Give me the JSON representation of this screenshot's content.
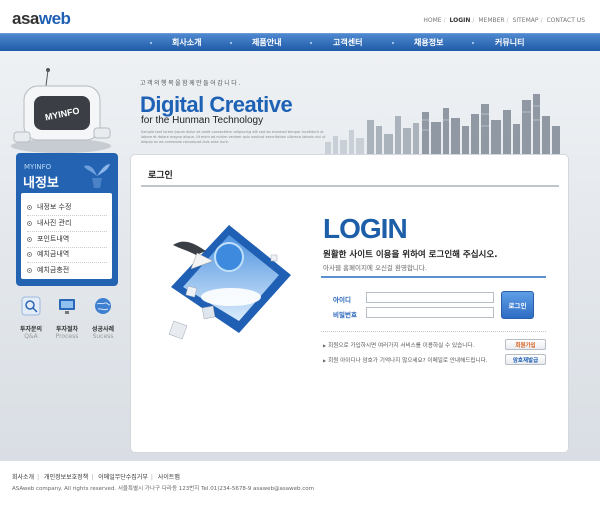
{
  "header": {
    "logo": {
      "part1": "asa",
      "part2": "web"
    },
    "top_links": [
      "HOME",
      "LOGIN",
      "MEMBER",
      "SITEMAP",
      "CONTACT US"
    ],
    "nav": [
      "회사소개",
      "제품안내",
      "고객센터",
      "채용정보",
      "커뮤니티"
    ]
  },
  "visual": {
    "tagline": "고객의행복을함께만들어갑니다.",
    "title_part1": "Digital ",
    "title_part2": "Creative",
    "subtitle": "for the Hunman Technology",
    "description": "Sample text lorem ipsum dolor sit amet consectetur adipiscing elit sed do eiusmod tempor incididunt ut labore et dolore magna aliqua. Ut enim ad minim veniam quis nostrud exercitation ullamco laboris nisi ut aliquip ex ea commodo consequat duis aute irure."
  },
  "left": {
    "robot_screen": "MYINFO",
    "section_en": "MYINFO",
    "section_ko": "내정보",
    "menu": [
      "내정보 수정",
      "내사진 관리",
      "포인트내역",
      "예치금내역",
      "예치금충전"
    ],
    "quick": [
      {
        "title": "투자문의",
        "sub": "Q&A"
      },
      {
        "title": "투자절차",
        "sub": "Process"
      },
      {
        "title": "성공사례",
        "sub": "Sucess"
      }
    ]
  },
  "content": {
    "title": "로그인",
    "login_title": "LOGIN",
    "login_message": "원활한 사이트 이용을 위하여 로그인해 주십시오.",
    "login_sub": "아사웹 홈페이지에 오신걸 환영합니다.",
    "id_label": "아이디",
    "pw_label": "비밀번호",
    "id_value": "",
    "pw_value": "",
    "login_button": "로그인",
    "note1": "회원으로 가입하시면 여러가지 서비스를 이용하실 수 있습니다.",
    "note1_button": "회원가입",
    "note2": "회원 아이디나 암호가 기억나지 않으세요? 이메일로 안내해드립니다.",
    "note2_button": "암호재발급"
  },
  "footer": {
    "links": [
      "회사소개",
      "개인정보보호정책",
      "이메일무단수집거부",
      "사이트맵"
    ],
    "copyright": "ASAweb company. All rights reserved. 서울특별시 가나구 다라동 123번지 Tel.01)234-5678-9  asaweb@asaweb.com"
  },
  "colors": {
    "brand_blue": "#1f5fb4",
    "nav_blue": "#2f6fc0",
    "panel_blue": "#2363b1"
  }
}
